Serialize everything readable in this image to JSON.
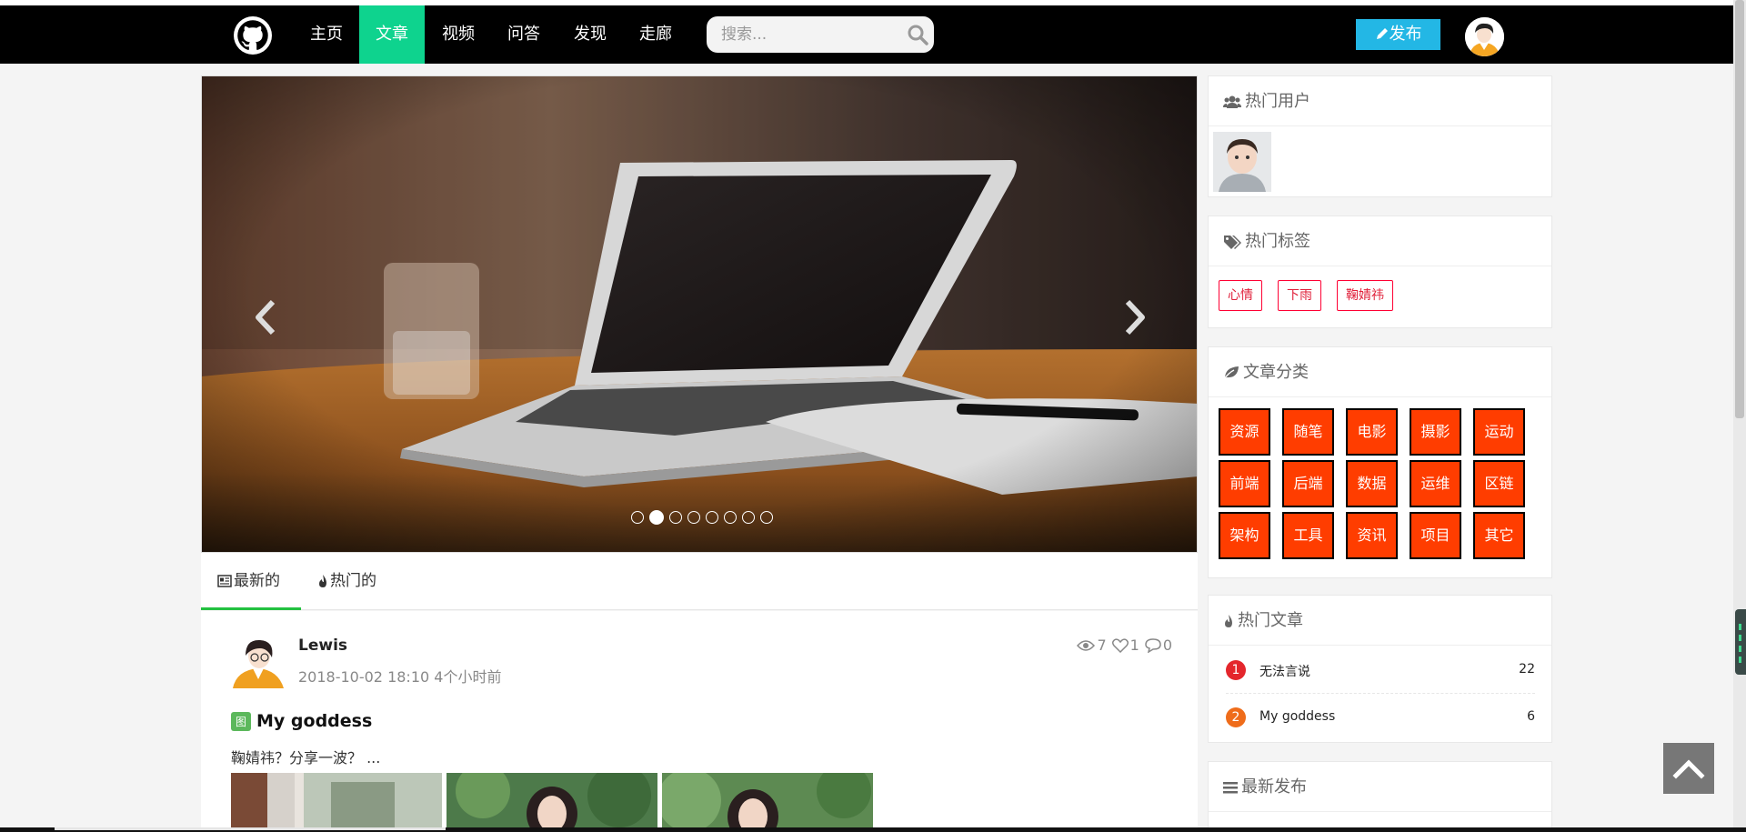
{
  "nav": {
    "items": [
      "主页",
      "文章",
      "视频",
      "问答",
      "发现",
      "走廊"
    ],
    "active_index": 1,
    "search_placeholder": "搜索...",
    "publish_label": "发布"
  },
  "carousel": {
    "slide_count": 8,
    "active_slide": 2
  },
  "tabs": [
    "最新的",
    "热门的"
  ],
  "post": {
    "author": "Lewis",
    "time": "2018-10-02 18:10 4个小时前",
    "views": "7",
    "likes": "1",
    "comments": "0",
    "badge": "图",
    "title": "My goddess",
    "summary": "鞠婧祎？分享一波？ ..."
  },
  "sidebar": {
    "hot_users_title": "热门用户",
    "hot_tags_title": "热门标签",
    "tags": [
      "心情",
      "下雨",
      "鞠婧祎"
    ],
    "categories_title": "文章分类",
    "categories": [
      "资源",
      "随笔",
      "电影",
      "摄影",
      "运动",
      "前端",
      "后端",
      "数据",
      "运维",
      "区链",
      "架构",
      "工具",
      "资讯",
      "项目",
      "其它"
    ],
    "hot_articles_title": "热门文章",
    "hot_articles": [
      {
        "rank": "1",
        "title": "无法言说",
        "count": "22"
      },
      {
        "rank": "2",
        "title": "My goddess",
        "count": "6"
      }
    ],
    "latest_title": "最新发布"
  },
  "colors": {
    "nav_bg": "#000000",
    "nav_active": "#0ed38e",
    "publish_btn": "#23b7e5",
    "category_bg": "#ff3d00",
    "tab_active_underline": "#23c140",
    "rank1": "#e4262c",
    "rank2": "#ef6c1a"
  }
}
